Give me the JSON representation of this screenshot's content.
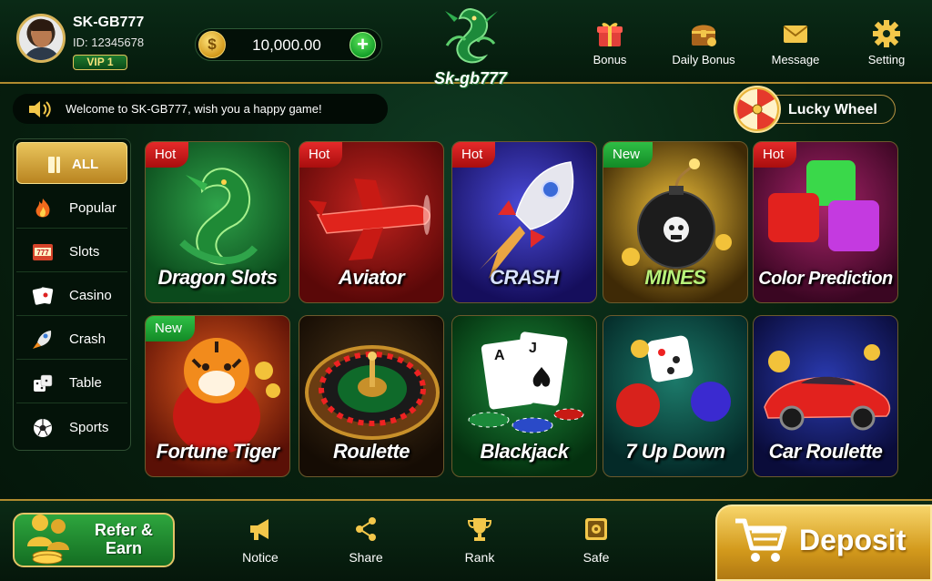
{
  "user": {
    "name": "SK-GB777",
    "id_label": "ID: 12345678",
    "vip": "VIP 1",
    "balance": "10,000.00",
    "coin_symbol": "$",
    "add_symbol": "+"
  },
  "logo": {
    "text": "Sk-gb777"
  },
  "top_nav": [
    {
      "label": "Bonus",
      "icon": "gift-icon"
    },
    {
      "label": "Daily Bonus",
      "icon": "treasure-chest-icon"
    },
    {
      "label": "Message",
      "icon": "envelope-icon"
    },
    {
      "label": "Setting",
      "icon": "gear-icon"
    }
  ],
  "notice": {
    "text": "Welcome to SK-GB777, wish you a happy game!",
    "icon": "speaker-icon"
  },
  "lucky_wheel": {
    "label": "Lucky Wheel",
    "icon": "prize-wheel-icon"
  },
  "categories": [
    {
      "label": "ALL",
      "icon": "all-grid-icon",
      "active": true
    },
    {
      "label": "Popular",
      "icon": "fire-icon"
    },
    {
      "label": "Slots",
      "icon": "slot-machine-icon"
    },
    {
      "label": "Casino",
      "icon": "playing-cards-icon"
    },
    {
      "label": "Crash",
      "icon": "rocket-icon"
    },
    {
      "label": "Table",
      "icon": "dice-icon"
    },
    {
      "label": "Sports",
      "icon": "soccer-ball-icon"
    }
  ],
  "games": [
    {
      "title": "Dragon Slots",
      "badge": "Hot",
      "badge_type": "hot",
      "art": "dragon"
    },
    {
      "title": "Aviator",
      "badge": "Hot",
      "badge_type": "hot",
      "art": "plane"
    },
    {
      "title": "CRASH",
      "badge": "Hot",
      "badge_type": "hot",
      "art": "rocket"
    },
    {
      "title": "MINES",
      "badge": "New",
      "badge_type": "new",
      "art": "bomb"
    },
    {
      "title": "Color Prediction",
      "badge": "Hot",
      "badge_type": "hot",
      "art": "cubes"
    },
    {
      "title": "Fortune Tiger",
      "badge": "New",
      "badge_type": "new",
      "art": "tiger"
    },
    {
      "title": "Roulette",
      "badge": "",
      "badge_type": "",
      "art": "roulette"
    },
    {
      "title": "Blackjack",
      "badge": "",
      "badge_type": "",
      "art": "cards"
    },
    {
      "title": "7 Up Down",
      "badge": "",
      "badge_type": "",
      "art": "dice"
    },
    {
      "title": "Car Roulette",
      "badge": "",
      "badge_type": "",
      "art": "car"
    }
  ],
  "bottom_nav": [
    {
      "label": "Notice",
      "icon": "megaphone-icon"
    },
    {
      "label": "Share",
      "icon": "share-icon"
    },
    {
      "label": "Rank",
      "icon": "trophy-icon"
    },
    {
      "label": "Safe",
      "icon": "safe-icon"
    }
  ],
  "refer": {
    "line1": "Refer &",
    "line2": "Earn",
    "icon": "people-coins-icon"
  },
  "deposit": {
    "label": "Deposit",
    "icon": "cart-icon"
  },
  "colors": {
    "gold": "#d8b45a",
    "hot_badge": "#e62a2a",
    "new_badge": "#2fbf45",
    "bg_green": "#07200f",
    "deposit_gold": "#d39a1c"
  }
}
